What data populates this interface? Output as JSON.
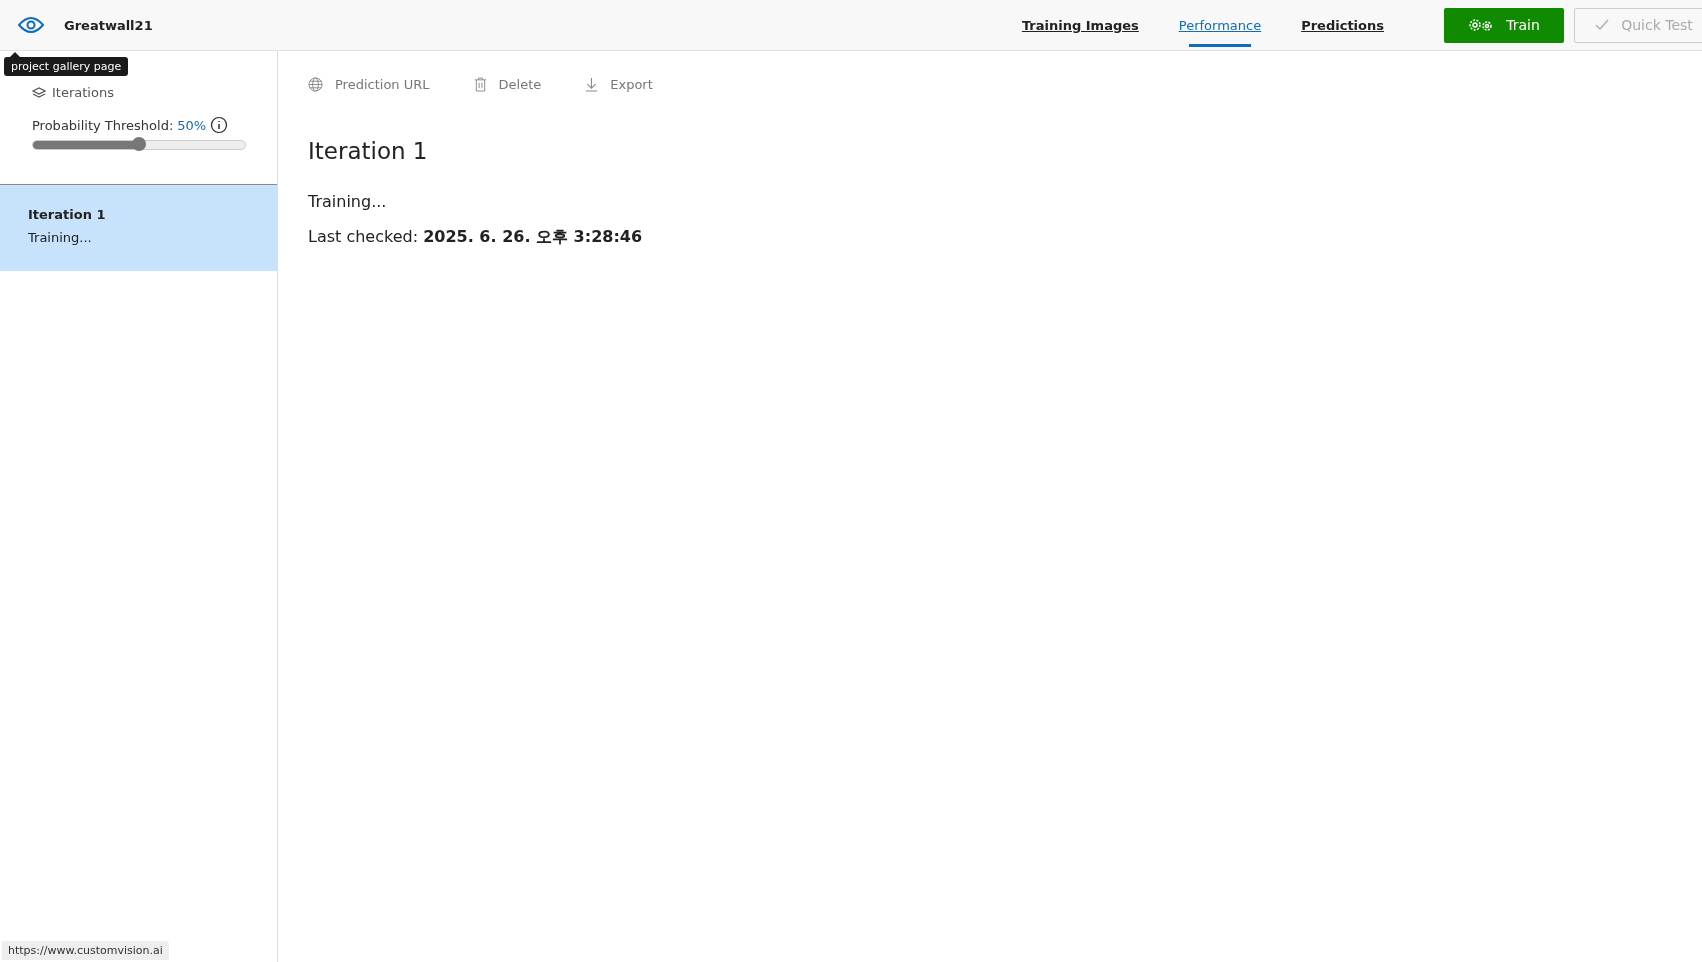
{
  "header": {
    "project_name": "Greatwall21",
    "tooltip": "project gallery page"
  },
  "tabs": [
    {
      "label": "Training Images",
      "selected": false
    },
    {
      "label": "Performance",
      "selected": true
    },
    {
      "label": "Predictions",
      "selected": false
    }
  ],
  "actions": [
    {
      "label": "Train",
      "kind": "train",
      "disabled": false
    },
    {
      "label": "Quick Test",
      "kind": "check",
      "disabled": true
    }
  ],
  "sidebar": {
    "heading": "Iterations",
    "threshold": {
      "label": "Probability Threshold:",
      "value": "50%",
      "level": 0.5
    },
    "iterations": [
      {
        "name": "Iteration 1",
        "status": "Training...",
        "selected": true
      }
    ]
  },
  "toolbar": [
    {
      "label": "Prediction URL",
      "kind": "globe"
    },
    {
      "label": "Delete",
      "kind": "trash"
    },
    {
      "label": "Export",
      "kind": "download"
    }
  ],
  "detail": {
    "title": "Iteration 1",
    "status": "Training...",
    "last_checked_label": "Last checked:",
    "last_checked": "2025. 6. 26. 오후 3:28:46"
  },
  "status_bar": {
    "url": "https://www.customvision.ai"
  }
}
